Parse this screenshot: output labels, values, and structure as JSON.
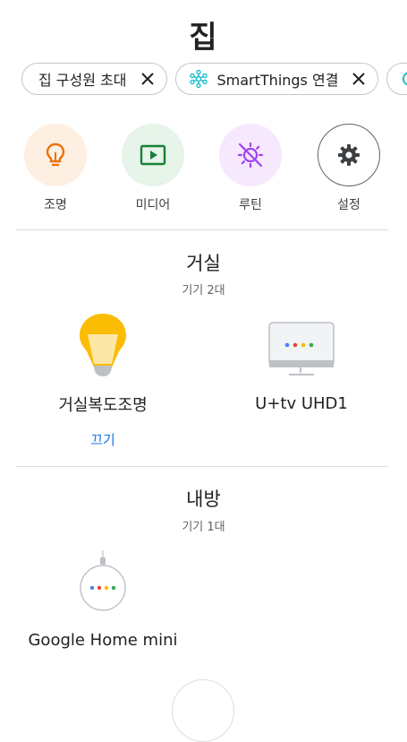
{
  "header": {
    "title": "집"
  },
  "chips": [
    {
      "label": "집 구성원 초대"
    },
    {
      "label": "SmartThings 연결"
    }
  ],
  "shortcuts": [
    {
      "label": "조명",
      "icon": "lightbulb-icon",
      "color": "#e8710a",
      "bg": "#feefe3"
    },
    {
      "label": "미디어",
      "icon": "play-screen-icon",
      "color": "#188038",
      "bg": "#e6f4ea"
    },
    {
      "label": "루틴",
      "icon": "routine-sun-icon",
      "color": "#a142f4",
      "bg": "#f6e8fd"
    },
    {
      "label": "설정",
      "icon": "gear-icon",
      "color": "#3c4043",
      "bg": "#ffffff"
    }
  ],
  "rooms": [
    {
      "name": "거실",
      "count": "기기 2대",
      "devices": [
        {
          "name": "거실복도조명",
          "icon": "smart-bulb-icon",
          "action": "끄기"
        },
        {
          "name": "U+tv UHD1",
          "icon": "tv-icon"
        }
      ]
    },
    {
      "name": "내방",
      "count": "기기 1대",
      "devices": [
        {
          "name": "Google Home mini",
          "icon": "speaker-icon"
        }
      ]
    }
  ]
}
